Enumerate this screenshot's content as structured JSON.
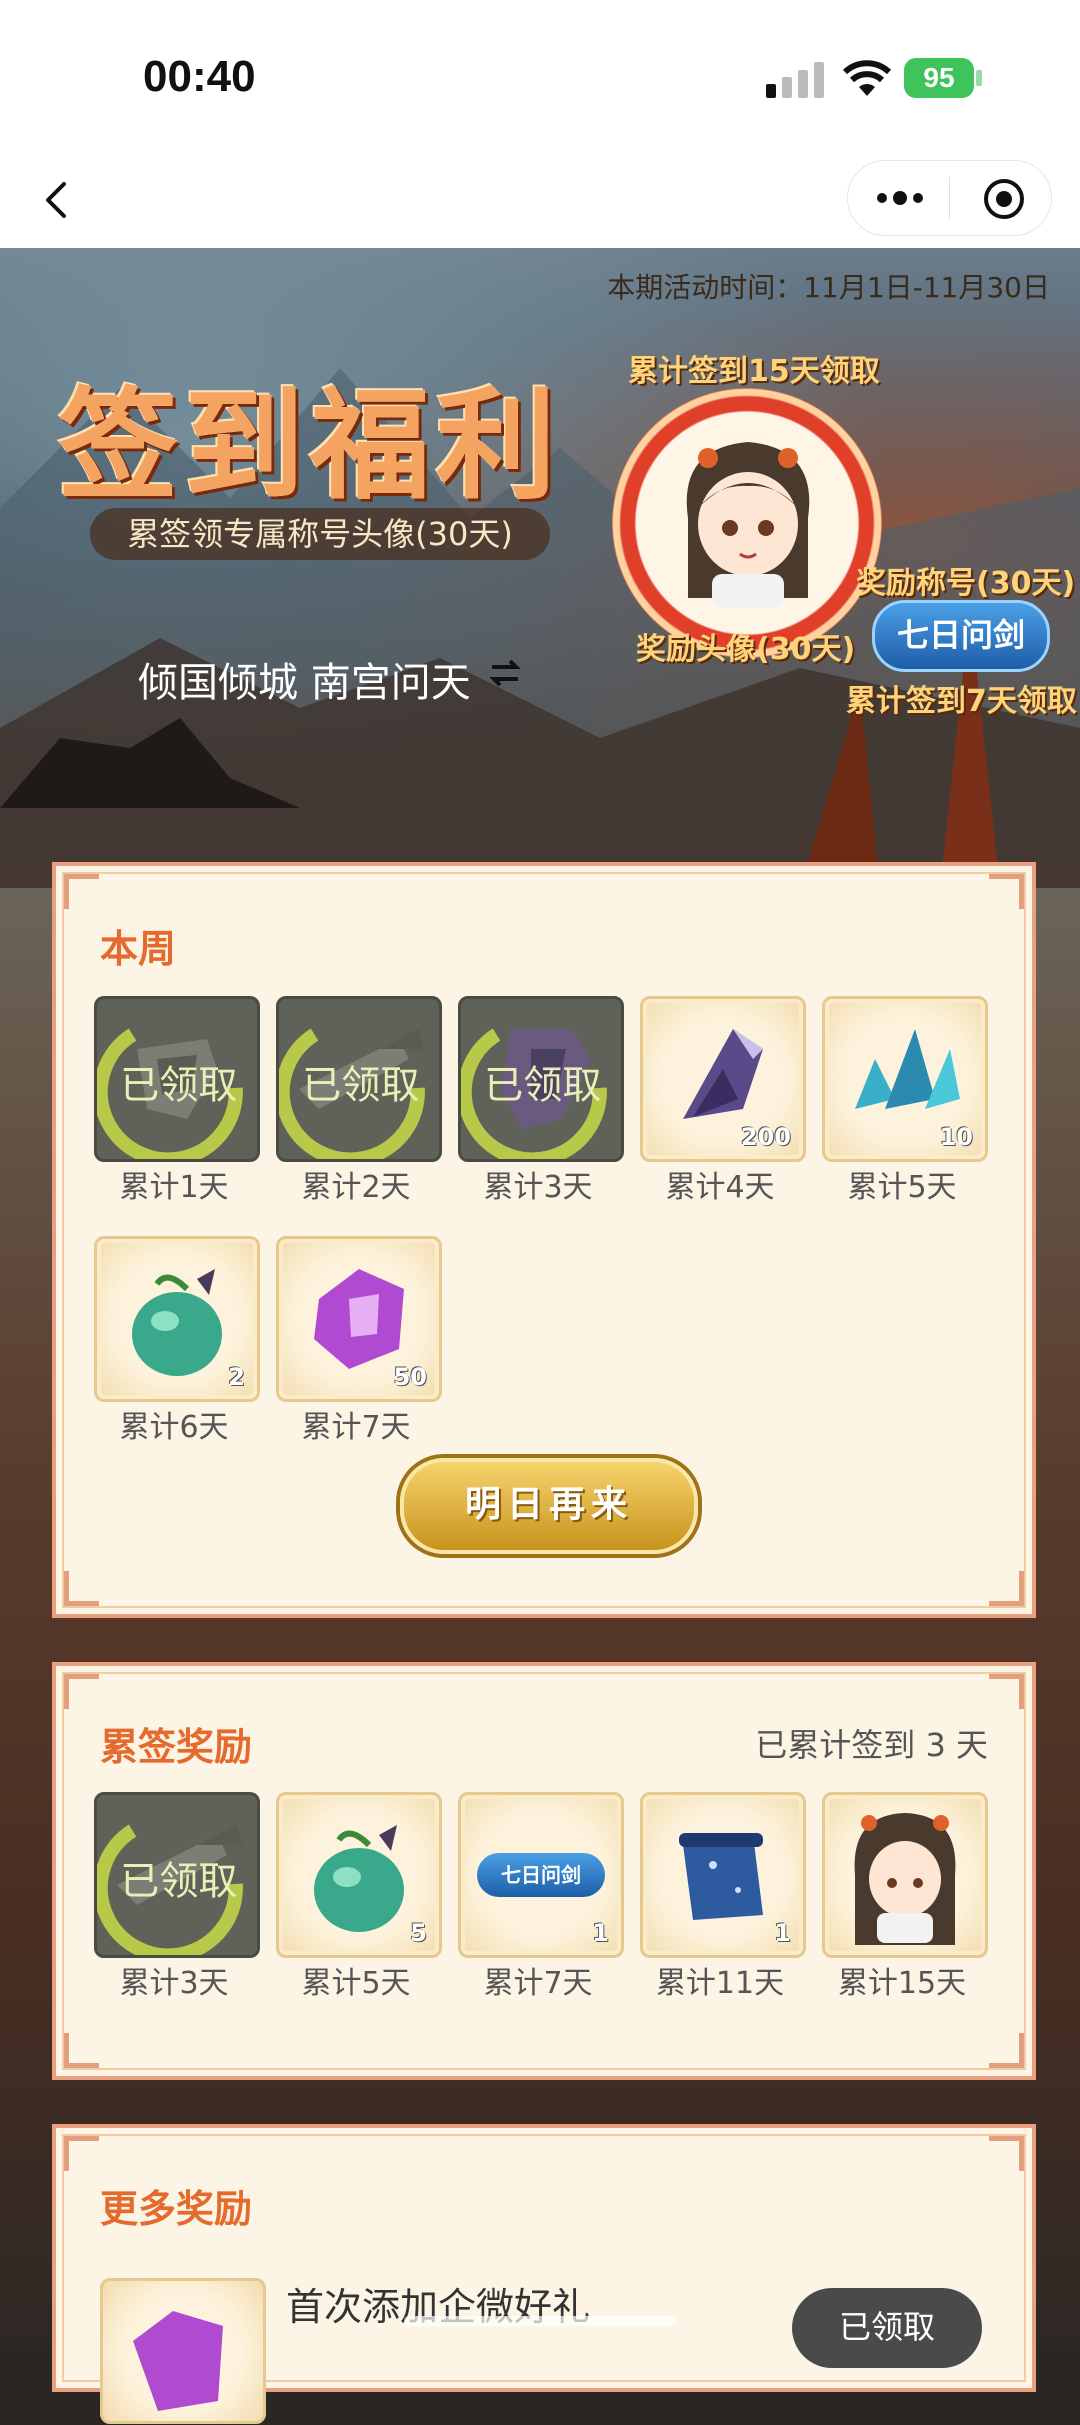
{
  "status_bar": {
    "time": "00:40",
    "battery": "95"
  },
  "banner": {
    "event_time": "本期活动时间：11月1日-11月30日",
    "title": "签到福利",
    "subtitle": "累签领专属称号头像(30天)",
    "player_name": "倾国倾城 南宫问天",
    "avatar_reward_top": "累计签到15天领取",
    "avatar_reward_caption": "奖励头像(30天)",
    "title_reward_caption": "奖励称号(30天)",
    "title_badge": "七日问剑",
    "title_reward_bottom": "累计签到7天领取"
  },
  "weekly": {
    "title": "本周",
    "items": [
      {
        "label": "累计1天",
        "icon": "armor-icon",
        "claimed": true,
        "qty": "",
        "stamp": "已领取"
      },
      {
        "label": "累计2天",
        "icon": "weapon-icon",
        "claimed": true,
        "qty": "",
        "stamp": "已领取"
      },
      {
        "label": "累计3天",
        "icon": "token-icon",
        "claimed": true,
        "qty": "",
        "stamp": "已领取"
      },
      {
        "label": "累计4天",
        "icon": "crystal-icon",
        "claimed": false,
        "qty": "200"
      },
      {
        "label": "累计5天",
        "icon": "blue-crystal-icon",
        "claimed": false,
        "qty": "10"
      },
      {
        "label": "累计6天",
        "icon": "fruit-icon",
        "claimed": false,
        "qty": "2"
      },
      {
        "label": "累计7天",
        "icon": "purple-token-icon",
        "claimed": false,
        "qty": "50"
      }
    ],
    "button": "明日再来"
  },
  "cumulative": {
    "title": "累签奖励",
    "progress": "已累计签到 3 天",
    "items": [
      {
        "label": "累计3天",
        "icon": "weapon-icon",
        "claimed": true,
        "qty": "",
        "stamp": "已领取"
      },
      {
        "label": "累计5天",
        "icon": "fruit-icon",
        "claimed": false,
        "qty": "5"
      },
      {
        "label": "累计7天",
        "icon": "title-badge-icon",
        "claimed": false,
        "qty": "1",
        "badge_text": "七日问剑"
      },
      {
        "label": "累计11天",
        "icon": "scroll-icon",
        "claimed": false,
        "qty": "1"
      },
      {
        "label": "累计15天",
        "icon": "avatar-icon",
        "claimed": false,
        "qty": ""
      }
    ]
  },
  "more": {
    "title": "更多奖励",
    "row_text": "首次添加企微好礼",
    "row_button": "已领取"
  },
  "colors": {
    "accent": "#e56a2e",
    "card_bg": "#fcf4e4",
    "button_gold": "#d9a933"
  }
}
